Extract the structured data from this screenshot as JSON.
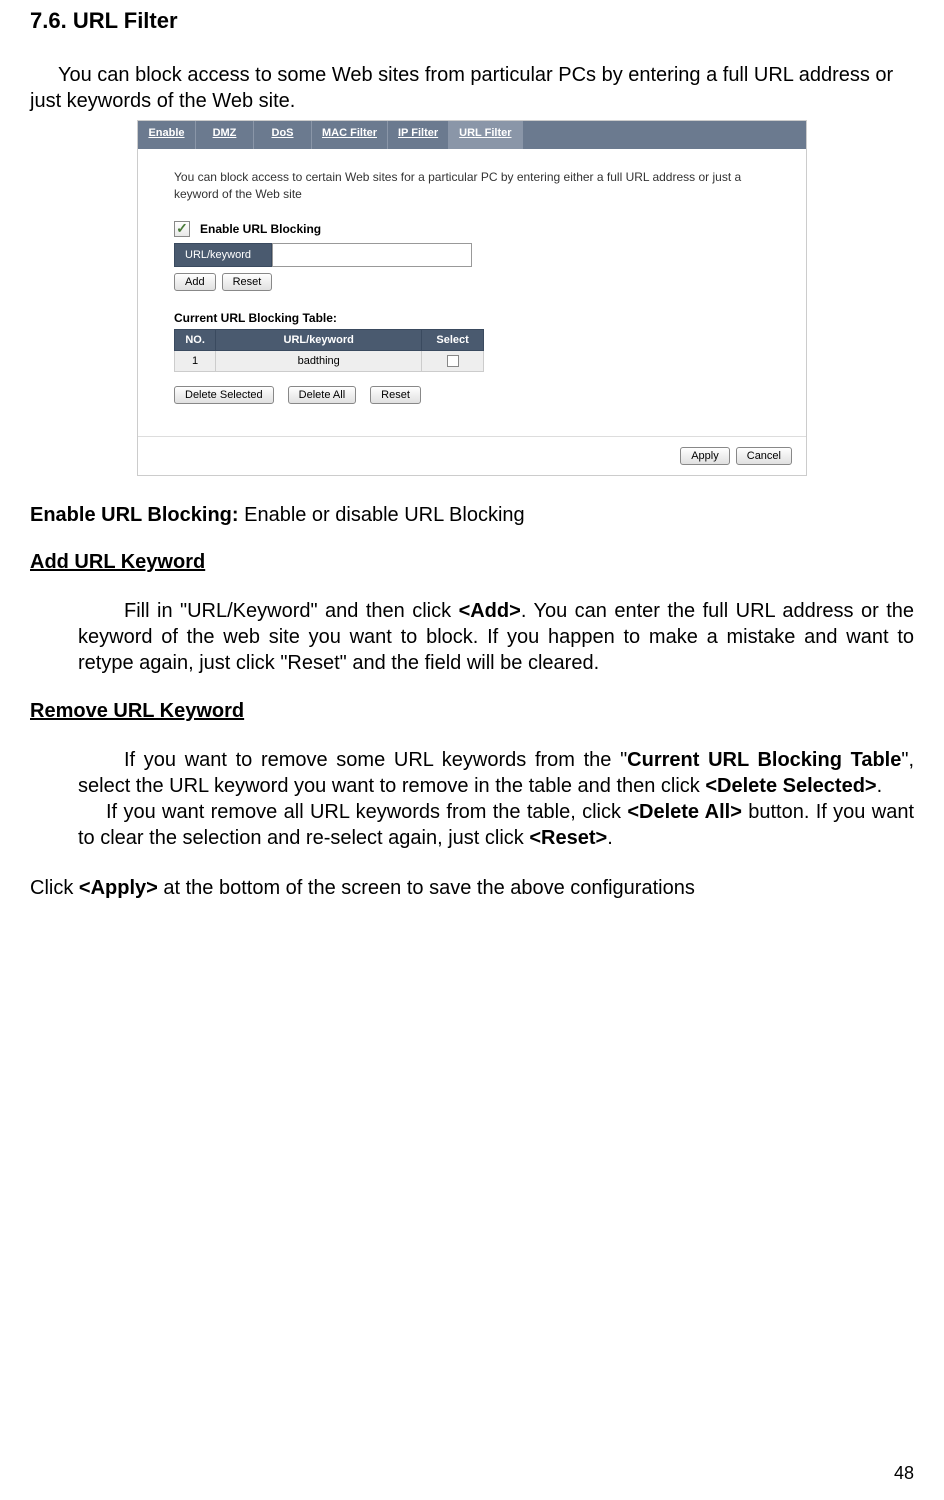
{
  "section_number": "7.6.",
  "section_title": "URL Filter",
  "intro": "You can block access to some Web sites from particular PCs by entering a full URL address or just keywords of the Web site.",
  "screenshot": {
    "tabs": [
      "Enable",
      "DMZ",
      "DoS",
      "MAC Filter",
      "IP Filter",
      "URL Filter"
    ],
    "active_tab_index": 5,
    "description": "You can block access to certain Web sites for a particular PC by entering either a full URL address or just a keyword of the Web site",
    "checkbox_label": "Enable URL Blocking",
    "checkbox_checked": true,
    "input_label": "URL/keyword",
    "add_btn": "Add",
    "reset_btn": "Reset",
    "table_title": "Current URL Blocking Table:",
    "headers": {
      "no": "NO.",
      "keyword": "URL/keyword",
      "select": "Select"
    },
    "rows": [
      {
        "no": "1",
        "keyword": "badthing",
        "selected": false
      }
    ],
    "delete_selected_btn": "Delete Selected",
    "delete_all_btn": "Delete All",
    "reset2_btn": "Reset",
    "apply_btn": "Apply",
    "cancel_btn": "Cancel"
  },
  "enable_label": "Enable URL Blocking:",
  "enable_desc": " Enable or disable URL Blocking",
  "add_heading": "Add URL Keyword",
  "add_text_1": "Fill in \"URL/Keyword\" and then click ",
  "add_bold": "<Add>",
  "add_text_2": ". You can enter the full URL address or the keyword of the web site you want to block. If you happen to make a mistake and want to retype again, just click \"Reset\" and the field will be cleared.",
  "remove_heading": "Remove URL Keyword",
  "remove_p1_part1": "If you want to remove some URL keywords from the \"",
  "remove_p1_bold1": "Current URL Blocking Table",
  "remove_p1_part2": "\", select the URL keyword you want to remove in the table and then click ",
  "remove_p1_bold2": "<Delete Selected>",
  "remove_p1_part3": ".",
  "remove_p2_part1": "If you want remove all URL keywords from the table, click ",
  "remove_p2_bold1": "<Delete All>",
  "remove_p2_part2": " button. If you want to clear the selection and re-select again, just click ",
  "remove_p2_bold2": "<Reset>",
  "remove_p2_part3": ".",
  "final_part1": "Click ",
  "final_bold": "<Apply>",
  "final_part2": " at the bottom of the screen to save the above configurations",
  "page_number": "48"
}
